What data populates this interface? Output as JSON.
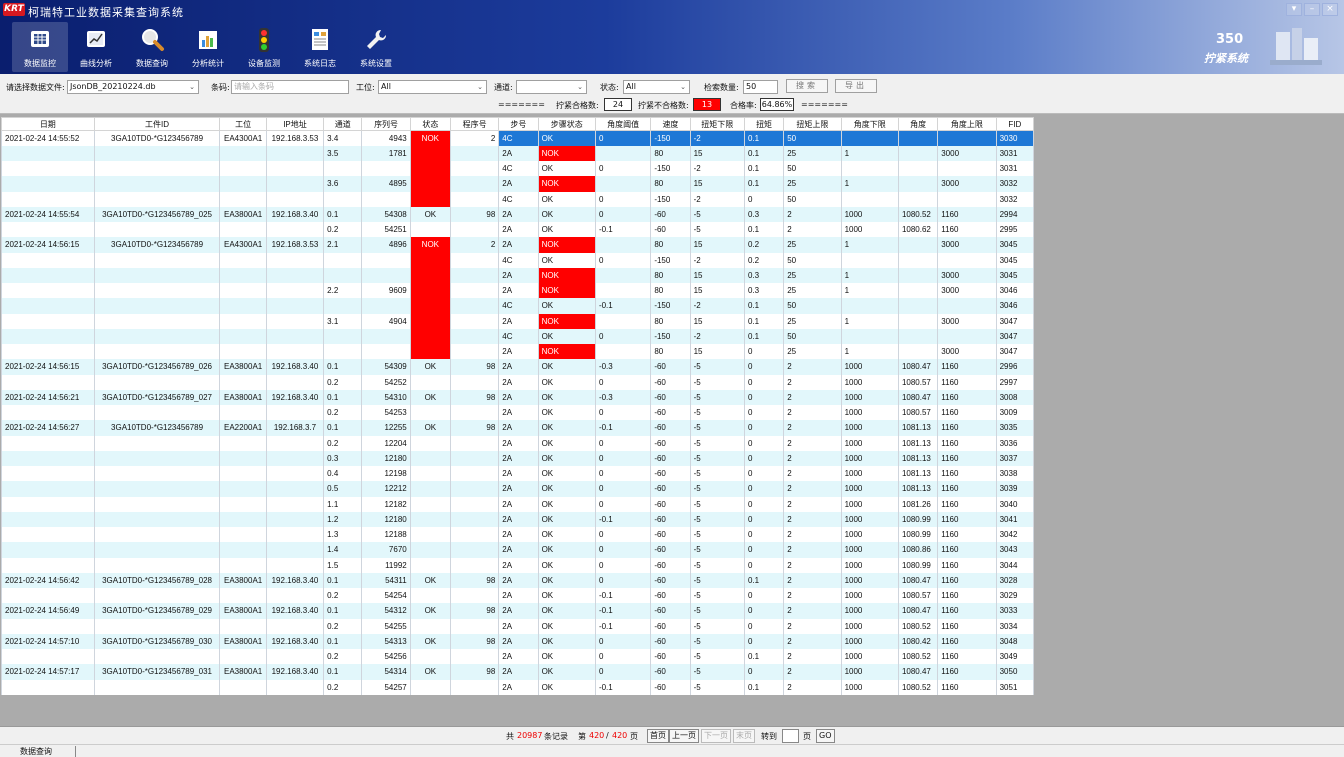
{
  "window": {
    "title": "柯瑞特工业数据采集查询系统",
    "logo": "KRT"
  },
  "nav": [
    {
      "label": "数据监控",
      "icon": "monitor-icon",
      "active": true
    },
    {
      "label": "曲线分析",
      "icon": "curve-icon"
    },
    {
      "label": "数据查询",
      "icon": "search-icon"
    },
    {
      "label": "分析统计",
      "icon": "chart-icon"
    },
    {
      "label": "设备监测",
      "icon": "traffic-light-icon"
    },
    {
      "label": "系统日志",
      "icon": "log-icon"
    },
    {
      "label": "系统设置",
      "icon": "wrench-icon"
    }
  ],
  "brand": {
    "number": "350",
    "text": "拧紧系统"
  },
  "filters": {
    "file_label": "请选择数据文件:",
    "file_value": "JsonDB_20210224.db",
    "barcode_label": "条码:",
    "barcode_placeholder": "请输入条码",
    "station_label": "工位:",
    "station_value": "All",
    "channel_label": "通道:",
    "channel_value": "",
    "status_label": "状态:",
    "status_value": "All",
    "count_label": "检索数量:",
    "count_value": "50",
    "search_button": "搜索",
    "export_button": "导出",
    "eq_left": "=======",
    "ok_label": "拧紧合格数:",
    "ok_value": "24",
    "nok_label": "拧紧不合格数:",
    "nok_value": "13",
    "rate_label": "合格率:",
    "rate_value": "64.86%",
    "eq_right": "======="
  },
  "columns": [
    "日期",
    "工件ID",
    "工位",
    "IP地址",
    "通道",
    "序列号",
    "状态",
    "程序号",
    "步号",
    "步骤状态",
    "角度阈值",
    "速度",
    "扭矩下限",
    "扭矩",
    "扭矩上限",
    "角度下限",
    "角度",
    "角度上限",
    "FID"
  ],
  "rows": [
    [
      "2021-02-24  14:55:52",
      "3GA10TD0-*G123456789",
      "EA4300A1",
      "192.168.3.53",
      "3.4",
      "4943",
      "NOK",
      "2",
      "4C",
      "OK",
      "0",
      "-150",
      "-2",
      "0.1",
      "50",
      "",
      "",
      "",
      "3030"
    ],
    [
      "",
      "",
      "",
      "",
      "3.5",
      "1781",
      "NOK",
      "",
      "2A",
      "NOK",
      "",
      "80",
      "15",
      "0.1",
      "25",
      "1",
      "",
      "3000",
      "3031"
    ],
    [
      "",
      "",
      "",
      "",
      "",
      "",
      "NOK",
      "",
      "4C",
      "OK",
      "0",
      "-150",
      "-2",
      "0.1",
      "50",
      "",
      "",
      "",
      "3031"
    ],
    [
      "",
      "",
      "",
      "",
      "3.6",
      "4895",
      "NOK",
      "",
      "2A",
      "NOK",
      "",
      "80",
      "15",
      "0.1",
      "25",
      "1",
      "",
      "3000",
      "3032"
    ],
    [
      "",
      "",
      "",
      "",
      "",
      "",
      "NOK",
      "",
      "4C",
      "OK",
      "0",
      "-150",
      "-2",
      "0",
      "50",
      "",
      "",
      "",
      "3032"
    ],
    [
      "2021-02-24  14:55:54",
      "3GA10TD0-*G123456789_025",
      "EA3800A1",
      "192.168.3.40",
      "0.1",
      "54308",
      "OK",
      "98",
      "2A",
      "OK",
      "0",
      "-60",
      "-5",
      "0.3",
      "2",
      "1000",
      "1080.52",
      "1160",
      "2994"
    ],
    [
      "",
      "",
      "",
      "",
      "0.2",
      "54251",
      "",
      "",
      "2A",
      "OK",
      "-0.1",
      "-60",
      "-5",
      "0.1",
      "2",
      "1000",
      "1080.62",
      "1160",
      "2995"
    ],
    [
      "2021-02-24  14:56:15",
      "3GA10TD0-*G123456789",
      "EA4300A1",
      "192.168.3.53",
      "2.1",
      "4896",
      "NOK",
      "2",
      "2A",
      "NOK",
      "",
      "80",
      "15",
      "0.2",
      "25",
      "1",
      "",
      "3000",
      "3045"
    ],
    [
      "",
      "",
      "",
      "",
      "",
      "",
      "NOK",
      "",
      "4C",
      "OK",
      "0",
      "-150",
      "-2",
      "0.2",
      "50",
      "",
      "",
      "",
      "3045"
    ],
    [
      "",
      "",
      "",
      "",
      "",
      "",
      "NOK",
      "",
      "2A",
      "NOK",
      "",
      "80",
      "15",
      "0.3",
      "25",
      "1",
      "",
      "3000",
      "3045"
    ],
    [
      "",
      "",
      "",
      "",
      "2.2",
      "9609",
      "NOK",
      "",
      "2A",
      "NOK",
      "",
      "80",
      "15",
      "0.3",
      "25",
      "1",
      "",
      "3000",
      "3046"
    ],
    [
      "",
      "",
      "",
      "",
      "",
      "",
      "NOK",
      "",
      "4C",
      "OK",
      "-0.1",
      "-150",
      "-2",
      "0.1",
      "50",
      "",
      "",
      "",
      "3046"
    ],
    [
      "",
      "",
      "",
      "",
      "3.1",
      "4904",
      "NOK",
      "",
      "2A",
      "NOK",
      "",
      "80",
      "15",
      "0.1",
      "25",
      "1",
      "",
      "3000",
      "3047"
    ],
    [
      "",
      "",
      "",
      "",
      "",
      "",
      "NOK",
      "",
      "4C",
      "OK",
      "0",
      "-150",
      "-2",
      "0.1",
      "50",
      "",
      "",
      "",
      "3047"
    ],
    [
      "",
      "",
      "",
      "",
      "",
      "",
      "NOK",
      "",
      "2A",
      "NOK",
      "",
      "80",
      "15",
      "0",
      "25",
      "1",
      "",
      "3000",
      "3047"
    ],
    [
      "2021-02-24  14:56:15",
      "3GA10TD0-*G123456789_026",
      "EA3800A1",
      "192.168.3.40",
      "0.1",
      "54309",
      "OK",
      "98",
      "2A",
      "OK",
      "-0.3",
      "-60",
      "-5",
      "0",
      "2",
      "1000",
      "1080.47",
      "1160",
      "2996"
    ],
    [
      "",
      "",
      "",
      "",
      "0.2",
      "54252",
      "",
      "",
      "2A",
      "OK",
      "0",
      "-60",
      "-5",
      "0",
      "2",
      "1000",
      "1080.57",
      "1160",
      "2997"
    ],
    [
      "2021-02-24  14:56:21",
      "3GA10TD0-*G123456789_027",
      "EA3800A1",
      "192.168.3.40",
      "0.1",
      "54310",
      "OK",
      "98",
      "2A",
      "OK",
      "-0.3",
      "-60",
      "-5",
      "0",
      "2",
      "1000",
      "1080.47",
      "1160",
      "3008"
    ],
    [
      "",
      "",
      "",
      "",
      "0.2",
      "54253",
      "",
      "",
      "2A",
      "OK",
      "0",
      "-60",
      "-5",
      "0",
      "2",
      "1000",
      "1080.57",
      "1160",
      "3009"
    ],
    [
      "2021-02-24  14:56:27",
      "3GA10TD0-*G123456789",
      "EA2200A1",
      "192.168.3.7",
      "0.1",
      "12255",
      "OK",
      "98",
      "2A",
      "OK",
      "-0.1",
      "-60",
      "-5",
      "0",
      "2",
      "1000",
      "1081.13",
      "1160",
      "3035"
    ],
    [
      "",
      "",
      "",
      "",
      "0.2",
      "12204",
      "",
      "",
      "2A",
      "OK",
      "0",
      "-60",
      "-5",
      "0",
      "2",
      "1000",
      "1081.13",
      "1160",
      "3036"
    ],
    [
      "",
      "",
      "",
      "",
      "0.3",
      "12180",
      "",
      "",
      "2A",
      "OK",
      "0",
      "-60",
      "-5",
      "0",
      "2",
      "1000",
      "1081.13",
      "1160",
      "3037"
    ],
    [
      "",
      "",
      "",
      "",
      "0.4",
      "12198",
      "",
      "",
      "2A",
      "OK",
      "0",
      "-60",
      "-5",
      "0",
      "2",
      "1000",
      "1081.13",
      "1160",
      "3038"
    ],
    [
      "",
      "",
      "",
      "",
      "0.5",
      "12212",
      "",
      "",
      "2A",
      "OK",
      "0",
      "-60",
      "-5",
      "0",
      "2",
      "1000",
      "1081.13",
      "1160",
      "3039"
    ],
    [
      "",
      "",
      "",
      "",
      "1.1",
      "12182",
      "",
      "",
      "2A",
      "OK",
      "0",
      "-60",
      "-5",
      "0",
      "2",
      "1000",
      "1081.26",
      "1160",
      "3040"
    ],
    [
      "",
      "",
      "",
      "",
      "1.2",
      "12180",
      "",
      "",
      "2A",
      "OK",
      "-0.1",
      "-60",
      "-5",
      "0",
      "2",
      "1000",
      "1080.99",
      "1160",
      "3041"
    ],
    [
      "",
      "",
      "",
      "",
      "1.3",
      "12188",
      "",
      "",
      "2A",
      "OK",
      "0",
      "-60",
      "-5",
      "0",
      "2",
      "1000",
      "1080.99",
      "1160",
      "3042"
    ],
    [
      "",
      "",
      "",
      "",
      "1.4",
      "7670",
      "",
      "",
      "2A",
      "OK",
      "0",
      "-60",
      "-5",
      "0",
      "2",
      "1000",
      "1080.86",
      "1160",
      "3043"
    ],
    [
      "",
      "",
      "",
      "",
      "1.5",
      "11992",
      "",
      "",
      "2A",
      "OK",
      "0",
      "-60",
      "-5",
      "0",
      "2",
      "1000",
      "1080.99",
      "1160",
      "3044"
    ],
    [
      "2021-02-24  14:56:42",
      "3GA10TD0-*G123456789_028",
      "EA3800A1",
      "192.168.3.40",
      "0.1",
      "54311",
      "OK",
      "98",
      "2A",
      "OK",
      "0",
      "-60",
      "-5",
      "0.1",
      "2",
      "1000",
      "1080.47",
      "1160",
      "3028"
    ],
    [
      "",
      "",
      "",
      "",
      "0.2",
      "54254",
      "",
      "",
      "2A",
      "OK",
      "-0.1",
      "-60",
      "-5",
      "0",
      "2",
      "1000",
      "1080.57",
      "1160",
      "3029"
    ],
    [
      "2021-02-24  14:56:49",
      "3GA10TD0-*G123456789_029",
      "EA3800A1",
      "192.168.3.40",
      "0.1",
      "54312",
      "OK",
      "98",
      "2A",
      "OK",
      "-0.1",
      "-60",
      "-5",
      "0",
      "2",
      "1000",
      "1080.47",
      "1160",
      "3033"
    ],
    [
      "",
      "",
      "",
      "",
      "0.2",
      "54255",
      "",
      "",
      "2A",
      "OK",
      "-0.1",
      "-60",
      "-5",
      "0",
      "2",
      "1000",
      "1080.52",
      "1160",
      "3034"
    ],
    [
      "2021-02-24  14:57:10",
      "3GA10TD0-*G123456789_030",
      "EA3800A1",
      "192.168.3.40",
      "0.1",
      "54313",
      "OK",
      "98",
      "2A",
      "OK",
      "0",
      "-60",
      "-5",
      "0",
      "2",
      "1000",
      "1080.42",
      "1160",
      "3048"
    ],
    [
      "",
      "",
      "",
      "",
      "0.2",
      "54256",
      "",
      "",
      "2A",
      "OK",
      "0",
      "-60",
      "-5",
      "0.1",
      "2",
      "1000",
      "1080.52",
      "1160",
      "3049"
    ],
    [
      "2021-02-24  14:57:17",
      "3GA10TD0-*G123456789_031",
      "EA3800A1",
      "192.168.3.40",
      "0.1",
      "54314",
      "OK",
      "98",
      "2A",
      "OK",
      "0",
      "-60",
      "-5",
      "0",
      "2",
      "1000",
      "1080.47",
      "1160",
      "3050"
    ],
    [
      "",
      "",
      "",
      "",
      "0.2",
      "54257",
      "",
      "",
      "2A",
      "OK",
      "-0.1",
      "-60",
      "-5",
      "0.1",
      "2",
      "1000",
      "1080.52",
      "1160",
      "3051"
    ]
  ],
  "pager": {
    "total_prefix": "共",
    "total": "20987",
    "total_suffix": "条记录",
    "page_prefix": "第",
    "current": "420",
    "slash": "/",
    "pages": "420",
    "page_suffix": "页",
    "first": "首页",
    "prev": "上一页",
    "next": "下一页",
    "last": "末页",
    "goto_label": "转到",
    "goto_value": "",
    "goto_suffix": "页",
    "go": "GO"
  },
  "status_bar": {
    "text": "数据查询"
  },
  "colors": {
    "nok": "#ff0000",
    "selected": "#1e78d6",
    "row_alt": "#e2f7fb",
    "title_bar": "#0a1e6e"
  }
}
